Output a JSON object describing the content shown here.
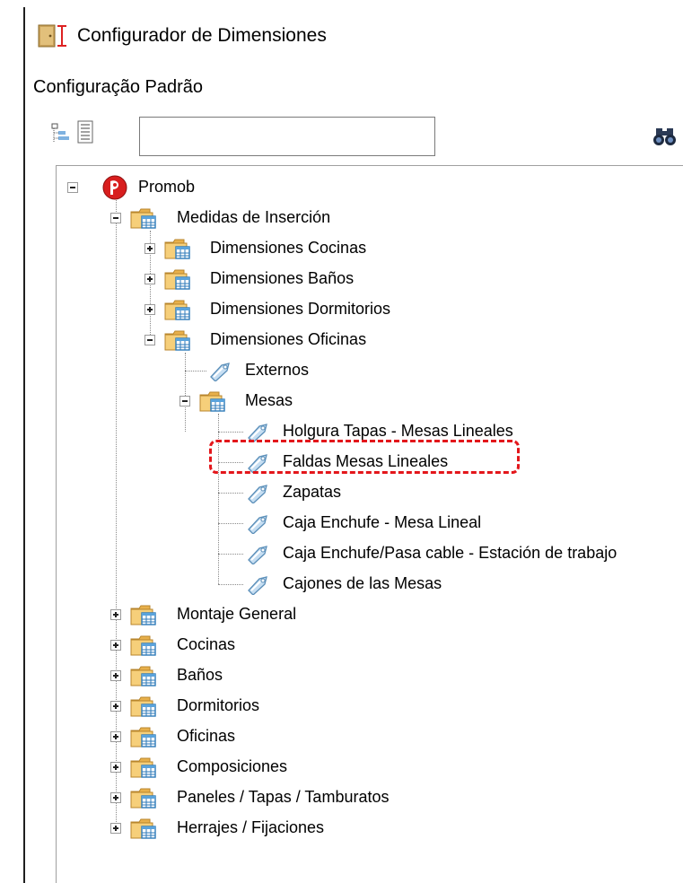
{
  "window": {
    "title": "Configurador de Dimensiones"
  },
  "header": {
    "config_name": "Configuração Padrão"
  },
  "toolbar": {
    "expand_all_icon": "tree-expand-icon",
    "collapse_all_icon": "tree-collapse-icon",
    "search_value": "",
    "find_icon": "binoculars-icon"
  },
  "tree": {
    "root": "Promob",
    "medidas": "Medidas de Inserción",
    "dim_cocinas": "Dimensiones Cocinas",
    "dim_banos": "Dimensiones Baños",
    "dim_dormitorios": "Dimensiones Dormitorios",
    "dim_oficinas": "Dimensiones Oficinas",
    "externos": "Externos",
    "mesas": "Mesas",
    "holgura": "Holgura Tapas - Mesas Lineales",
    "faldas": "Faldas Mesas Lineales",
    "zapatas": "Zapatas",
    "caja_enchufe": "Caja Enchufe - Mesa Lineal",
    "caja_pasa": "Caja Enchufe/Pasa cable - Estación de trabajo",
    "cajones": "Cajones de las Mesas",
    "montaje": "Montaje General",
    "cocinas": "Cocinas",
    "banos": "Baños",
    "dormitorios": "Dormitorios",
    "oficinas": "Oficinas",
    "composiciones": "Composiciones",
    "paneles": "Paneles / Tapas / Tamburatos",
    "herrajes": "Herrajes / Fijaciones"
  },
  "colors": {
    "highlight": "#e3161b",
    "folder": "#f2c46a",
    "tag": "#6fa8dc",
    "promob_logo": "#d81e1e"
  }
}
